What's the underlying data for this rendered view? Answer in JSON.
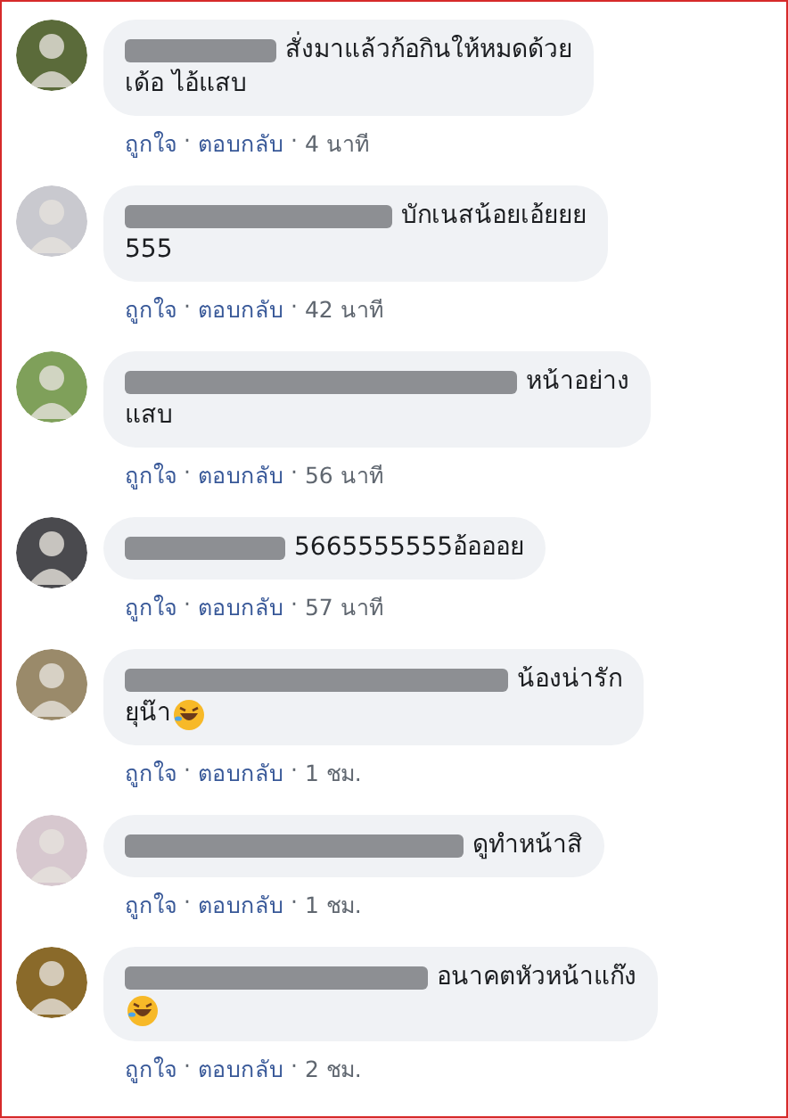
{
  "separator": "·",
  "comments": [
    {
      "lines": [
        "สั่งมาแล้วก้อกินให้หมดด้วย",
        "เด้อ ไอ้แสบ"
      ],
      "emoji": false,
      "like": "ถูกใจ",
      "reply": "ตอบกลับ",
      "time": "4 นาที"
    },
    {
      "lines": [
        "บักเนสน้อยเอ้ยยย",
        "555"
      ],
      "emoji": false,
      "like": "ถูกใจ",
      "reply": "ตอบกลับ",
      "time": "42 นาที"
    },
    {
      "lines": [
        "หน้าอย่าง",
        "แสบ"
      ],
      "emoji": false,
      "like": "ถูกใจ",
      "reply": "ตอบกลับ",
      "time": "56 นาที"
    },
    {
      "lines": [
        "5665555555อ้อออย"
      ],
      "emoji": false,
      "like": "ถูกใจ",
      "reply": "ตอบกลับ",
      "time": "57 นาที"
    },
    {
      "lines": [
        "น้องน่ารัก",
        "ยุน๊า"
      ],
      "emoji": true,
      "like": "ถูกใจ",
      "reply": "ตอบกลับ",
      "time": "1 ชม."
    },
    {
      "lines": [
        "ดูทำหน้าสิ"
      ],
      "emoji": false,
      "like": "ถูกใจ",
      "reply": "ตอบกลับ",
      "time": "1 ชม."
    },
    {
      "lines": [
        "อนาคตหัวหน้าแก๊ง"
      ],
      "emoji": true,
      "like": "ถูกใจ",
      "reply": "ตอบกลับ",
      "time": "2 ชม."
    }
  ]
}
